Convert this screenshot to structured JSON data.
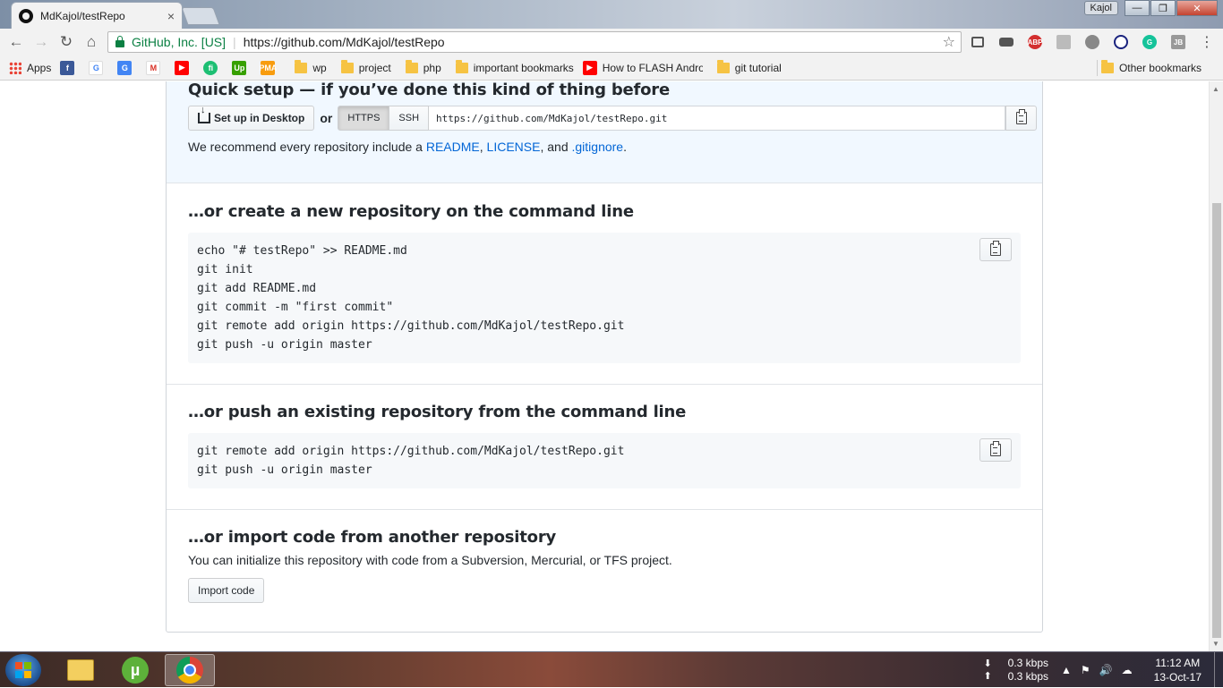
{
  "browser": {
    "tab_title": "MdKajol/testRepo",
    "tab_close": "×",
    "profile_name": "Kajol",
    "cert_name": "GitHub, Inc. [US]",
    "url": "https://github.com/MdKajol/testRepo",
    "extensions": [
      "cast-icon",
      "car-icon",
      "adblock-icon",
      "acrobat-icon",
      "cloud-icon",
      "block-icon",
      "grammarly-icon",
      "jb-icon",
      "menu-icon"
    ]
  },
  "bookmarks": {
    "apps_label": "Apps",
    "items": [
      "wp",
      "project",
      "php",
      "important bookmarks",
      "How to FLASH Andro",
      "git tutorial"
    ],
    "other_label": "Other bookmarks"
  },
  "quick_setup": {
    "title": "Quick setup — if you’ve done this kind of thing before",
    "desktop_button": "Set up in Desktop",
    "or_label": "or",
    "https_label": "HTTPS",
    "ssh_label": "SSH",
    "clone_url": "https://github.com/MdKajol/testRepo.git",
    "recommend_prefix": "We recommend every repository include a",
    "readme_link": "README",
    "license_link": "LICENSE",
    "and_label": "and",
    "gitignore_link": ".gitignore"
  },
  "create_section": {
    "title": "…or create a new repository on the command line",
    "lines": [
      "echo \"# testRepo\" >> README.md",
      "git init",
      "git add README.md",
      "git commit -m \"first commit\"",
      "git remote add origin https://github.com/MdKajol/testRepo.git",
      "git push -u origin master"
    ]
  },
  "push_section": {
    "title": "…or push an existing repository from the command line",
    "lines": [
      "git remote add origin https://github.com/MdKajol/testRepo.git",
      "git push -u origin master"
    ]
  },
  "import_section": {
    "title": "…or import code from another repository",
    "description": "You can initialize this repository with code from a Subversion, Mercurial, or TFS project.",
    "button": "Import code"
  },
  "taskbar": {
    "download_speed": "0.3 kbps",
    "upload_speed": "0.3 kbps",
    "time": "11:12 AM",
    "date": "13-Oct-17"
  }
}
